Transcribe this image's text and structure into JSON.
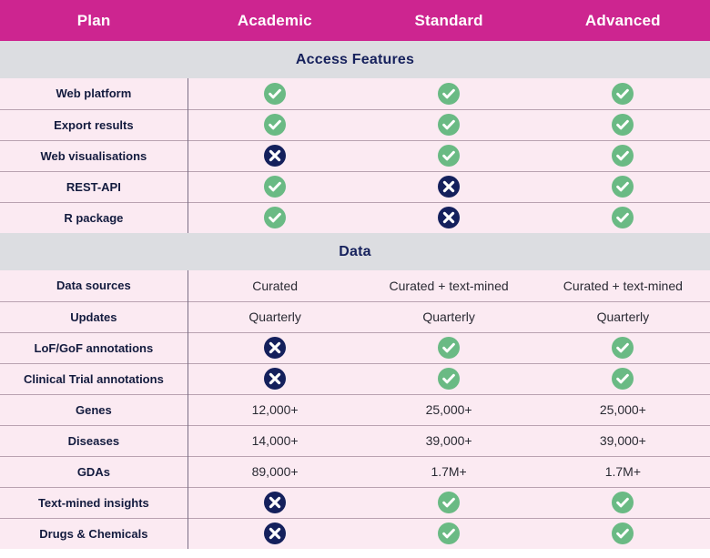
{
  "table": {
    "columns": [
      "Plan",
      "Academic",
      "Standard",
      "Advanced"
    ],
    "colors": {
      "header_bg": "#cd2590",
      "header_text": "#ffffff",
      "section_bg": "#dcdde1",
      "section_text": "#16215c",
      "row_bg": "#fbeaf2",
      "label_text": "#131b3e",
      "check_bg": "#6aba84",
      "cross_bg": "#14205c",
      "divider": "#b9a2b1"
    },
    "sections": [
      {
        "title": "Access Features",
        "rows": [
          {
            "label": "Web platform",
            "academic": "check-icon",
            "standard": "check-icon",
            "advanced": "check-icon"
          },
          {
            "label": "Export results",
            "academic": "check-icon",
            "standard": "check-icon",
            "advanced": "check-icon"
          },
          {
            "label": "Web visualisations",
            "academic": "cross-icon",
            "standard": "check-icon",
            "advanced": "check-icon"
          },
          {
            "label": "REST-API",
            "academic": "check-icon",
            "standard": "cross-icon",
            "advanced": "check-icon"
          },
          {
            "label": "R package",
            "academic": "check-icon",
            "standard": "cross-icon",
            "advanced": "check-icon"
          }
        ]
      },
      {
        "title": "Data",
        "rows": [
          {
            "label": "Data sources",
            "academic": "Curated",
            "standard": "Curated + text-mined",
            "advanced": "Curated + text-mined"
          },
          {
            "label": "Updates",
            "academic": "Quarterly",
            "standard": "Quarterly",
            "advanced": "Quarterly"
          },
          {
            "label": "LoF/GoF annotations",
            "academic": "cross-icon",
            "standard": "check-icon",
            "advanced": "check-icon"
          },
          {
            "label": "Clinical Trial annotations",
            "academic": "cross-icon",
            "standard": "check-icon",
            "advanced": "check-icon"
          },
          {
            "label": "Genes",
            "academic": "12,000+",
            "standard": "25,000+",
            "advanced": "25,000+"
          },
          {
            "label": "Diseases",
            "academic": "14,000+",
            "standard": "39,000+",
            "advanced": "39,000+"
          },
          {
            "label": "GDAs",
            "academic": "89,000+",
            "standard": "1.7M+",
            "advanced": "1.7M+"
          },
          {
            "label": "Text-mined insights",
            "academic": "cross-icon",
            "standard": "check-icon",
            "advanced": "check-icon"
          },
          {
            "label": "Drugs & Chemicals",
            "academic": "cross-icon",
            "standard": "check-icon",
            "advanced": "check-icon"
          }
        ]
      }
    ]
  }
}
